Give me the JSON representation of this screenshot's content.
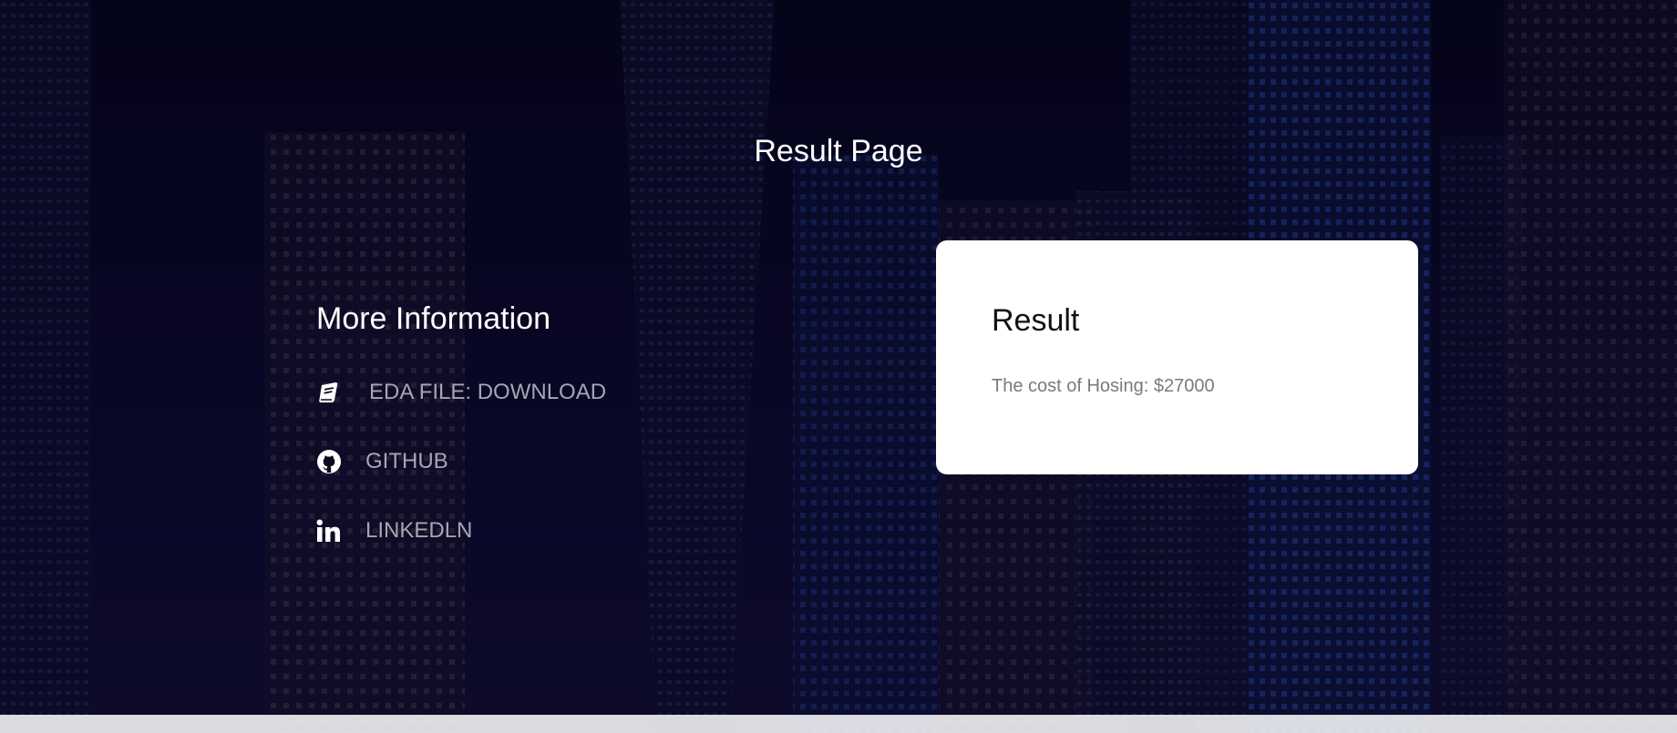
{
  "page": {
    "title": "Result Page"
  },
  "info": {
    "heading": "More Information",
    "links": [
      {
        "label": "EDA FILE: DOWNLOAD",
        "icon": "book-icon"
      },
      {
        "label": "GITHUB",
        "icon": "github-icon"
      },
      {
        "label": "LINKEDLN",
        "icon": "linkedin-icon"
      }
    ]
  },
  "result": {
    "heading": "Result",
    "text": "The cost of Hosing: $27000"
  },
  "colors": {
    "background": "#0b0a1e",
    "card": "#ffffff",
    "link_text": "#a6a6b3",
    "result_text": "#7a7a7a"
  }
}
